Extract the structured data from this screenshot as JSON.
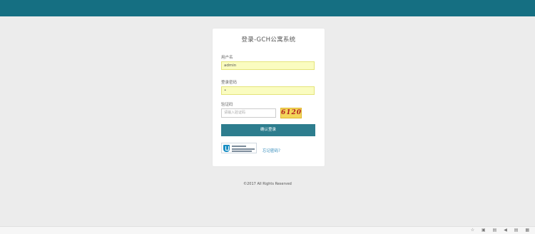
{
  "login": {
    "title": "登录-GCH公寓系统",
    "username_label": "用户名",
    "username_value": "admin",
    "password_label": "登录密码",
    "password_value": "•",
    "captcha_label": "验证码",
    "captcha_placeholder": "请输入验证码",
    "captcha_text": "6120",
    "submit_label": "确认登录",
    "forgot_link": "忘记密码？"
  },
  "footer": {
    "copyright": "©2017 All Rights Reserved"
  },
  "taskbar": {
    "icons": [
      "☆",
      "▣",
      "▤",
      "◀",
      "▤",
      "▦"
    ]
  }
}
